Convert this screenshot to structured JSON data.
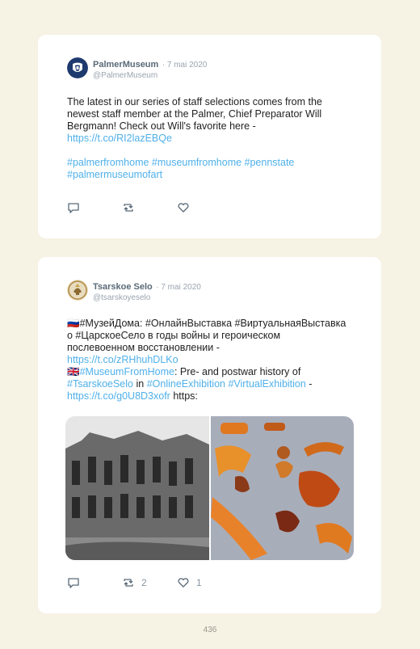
{
  "tweets": [
    {
      "name": "PalmerMuseum",
      "date": "7 mai 2020",
      "handle": "@PalmerMuseum",
      "body": "The latest in our series of staff selections comes from the newest staff member at the Palmer, Chief Preparator Will Bergmann! Check out Will's favorite here -",
      "link": "https://t.co/RI2lazEBQe",
      "hashtags": "#palmerfromhome #museumfromhome #pennstate #palmermuseumofart"
    },
    {
      "name": "Tsarskoe Selo",
      "date": "7 mai 2020",
      "handle": "@tsarskoyeselo",
      "ru_flag": "🇷🇺",
      "ru_text": "#МузейДома: #ОнлайнВыставка #ВиртуальнаяВыставка о #ЦарскоеСело в годы войны и героическом послевоенном восстановлении -",
      "ru_link": "https://t.co/zRHhuhDLKo",
      "uk_flag": "🇬🇧",
      "tag_museum": "#MuseumFromHome",
      "en_text": ": Pre- and postwar history of",
      "tag_tsarskoe": "#TsarskoeSelo",
      "in_word": " in ",
      "tag_online": "#OnlineExhibition",
      "tag_virtual": "#VirtualExhibition",
      "dash": " -",
      "en_link": "https://t.co/g0U8D3xofr",
      "https": " https:",
      "retweets": "2",
      "likes": "1"
    }
  ],
  "page_number": "436",
  "colors": {
    "link": "#4fb0ea",
    "background": "#f6f2e4",
    "card": "#ffffff"
  },
  "icons": [
    "reply-icon",
    "retweet-icon",
    "like-icon"
  ]
}
